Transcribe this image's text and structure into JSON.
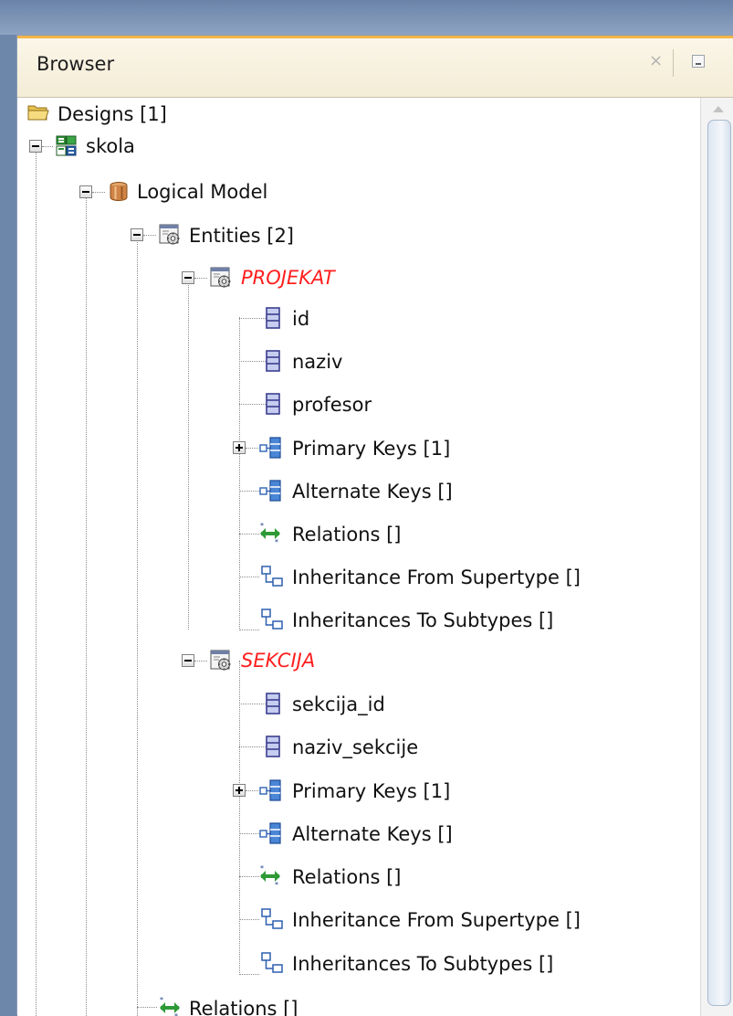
{
  "panel": {
    "title": "Browser",
    "close_glyph": "×"
  },
  "colors": {
    "entity_name": "#ff1f1f",
    "accent_tab": "#f2b548"
  },
  "tree": {
    "designs": {
      "label": "Designs [1]",
      "icon": "folder-icon"
    },
    "skola": {
      "label": "skola",
      "icon": "design-icon"
    },
    "logical_model": {
      "label": "Logical Model",
      "icon": "logical-model-icon"
    },
    "entities": {
      "label": "Entities [2]",
      "icon": "entities-icon"
    },
    "projekat": {
      "label": "PROJEKAT",
      "attributes": [
        "id",
        "naziv",
        "profesor"
      ],
      "primary_keys": "Primary Keys [1]",
      "alternate_keys": "Alternate Keys []",
      "relations": "Relations []",
      "inherit_from": "Inheritance From Supertype []",
      "inherit_to": "Inheritances To Subtypes []"
    },
    "sekcija": {
      "label": "SEKCIJA",
      "attributes": [
        "sekcija_id",
        "naziv_sekcije"
      ],
      "primary_keys": "Primary Keys [1]",
      "alternate_keys": "Alternate Keys []",
      "relations": "Relations []",
      "inherit_from": "Inheritance From Supertype []",
      "inherit_to": "Inheritances To Subtypes []"
    },
    "relations": {
      "label": "Relations []"
    }
  }
}
